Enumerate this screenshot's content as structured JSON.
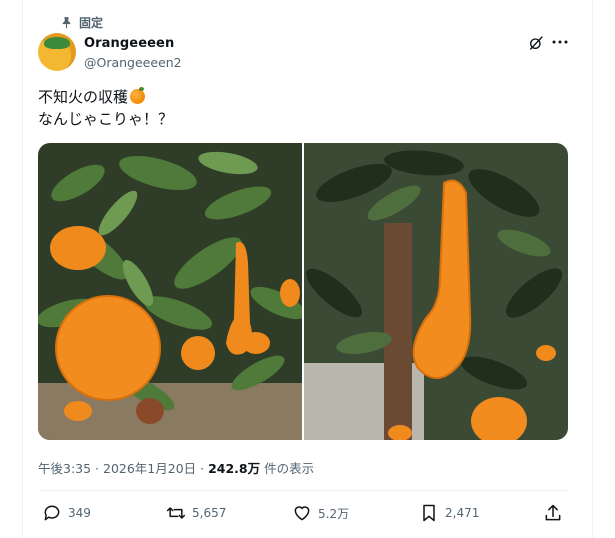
{
  "pinned_label": "固定",
  "author": {
    "display_name": "Orangeeeen",
    "handle": "@Orangeeeen2"
  },
  "tweet": {
    "line1": "不知火の収穫",
    "line1_emoji": "orange-emoji",
    "line2": "なんじゃこりゃ！？"
  },
  "media": {
    "images": [
      "orange-tree-photo",
      "elongated-orange-photo"
    ]
  },
  "meta": {
    "time_date": "午後3:35 · 2026年1月20日 · ",
    "views": "242.8万",
    "views_suffix": " 件の表示"
  },
  "actions": {
    "replies": "349",
    "reposts": "5,657",
    "likes": "5.2万",
    "bookmarks": "2,471"
  },
  "colors": {
    "text": "#0f1419",
    "secondary": "#536471",
    "orange": "#f28c1e"
  }
}
